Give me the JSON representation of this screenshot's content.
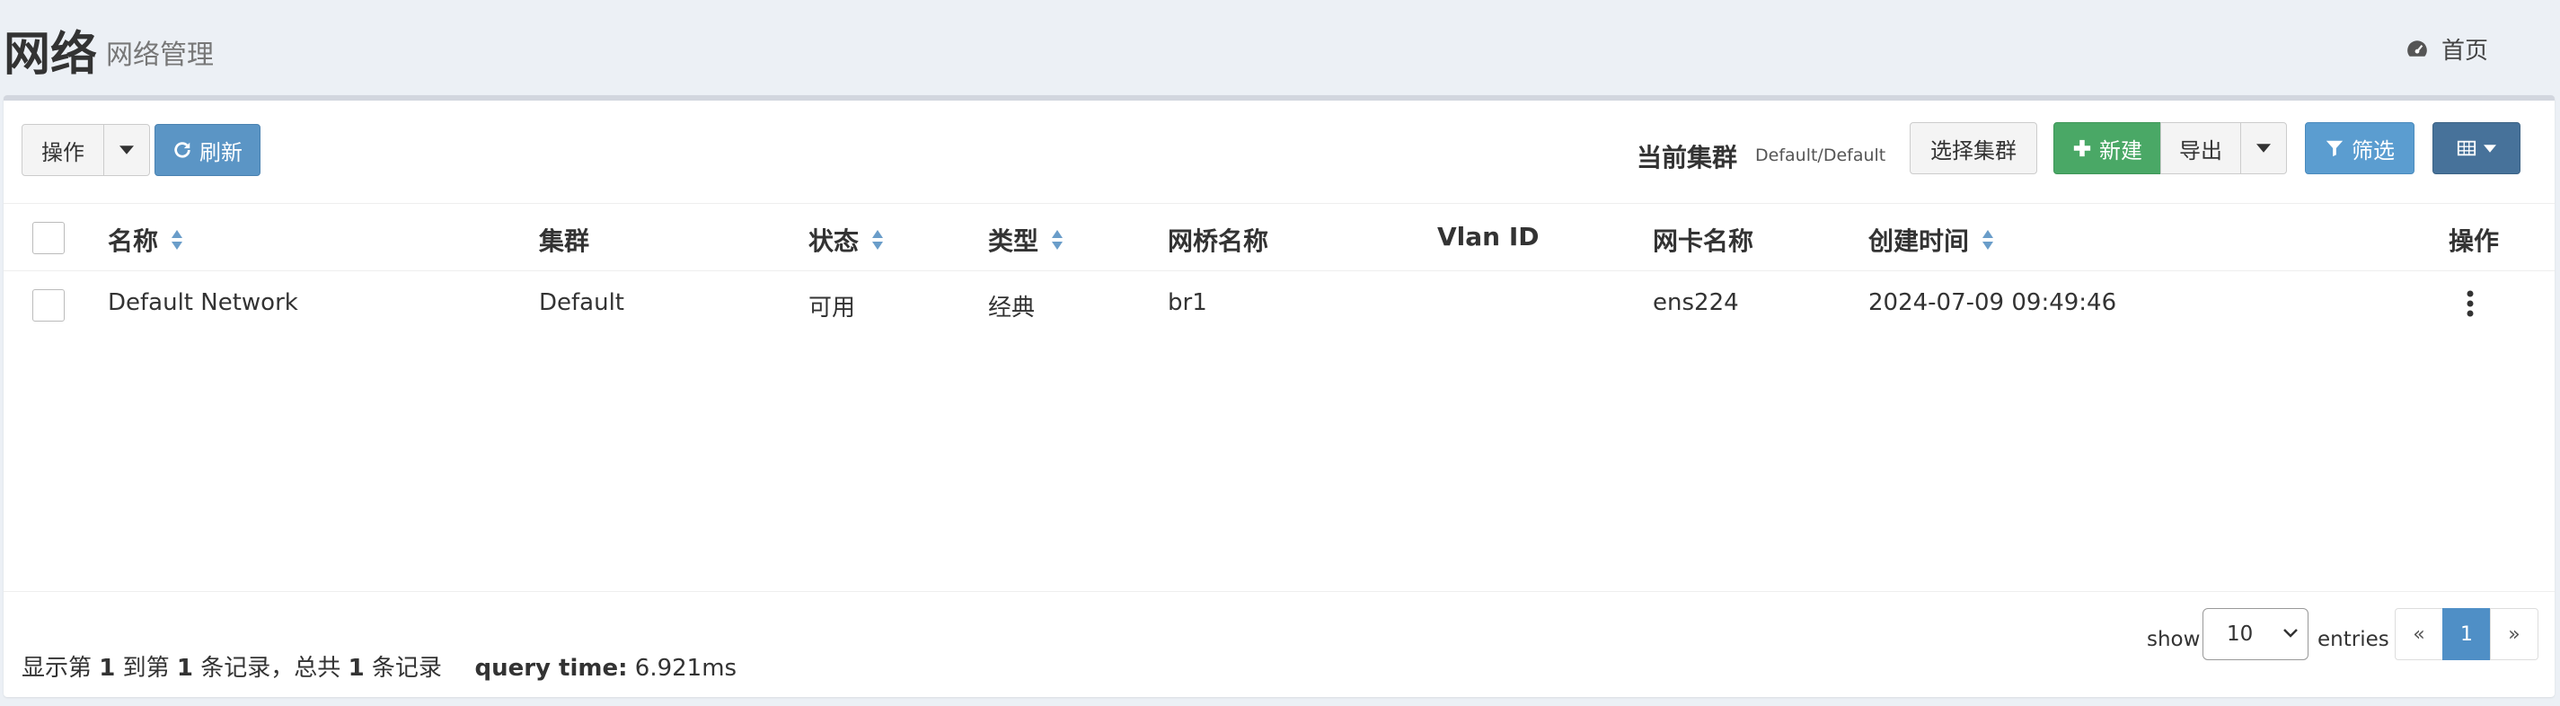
{
  "header": {
    "title": "网络",
    "subtitle": "网络管理",
    "home_label": "首页"
  },
  "toolbar": {
    "actions_label": "操作",
    "refresh_label": "刷新",
    "current_cluster_label": "当前集群",
    "current_cluster_value": "Default/Default",
    "select_cluster_label": "选择集群",
    "new_label": "新建",
    "export_label": "导出",
    "filter_label": "筛选"
  },
  "table": {
    "columns": [
      "名称",
      "集群",
      "状态",
      "类型",
      "网桥名称",
      "Vlan ID",
      "网卡名称",
      "创建时间",
      "操作"
    ],
    "rows": [
      {
        "name": "Default Network",
        "cluster": "Default",
        "status": "可用",
        "type": "经典",
        "bridge": "br1",
        "vlan": "",
        "nic": "ens224",
        "created": "2024-07-09 09:49:46"
      }
    ]
  },
  "footer": {
    "summary_prefix": "显示第",
    "from": "1",
    "summary_mid1": "到第",
    "to": "1",
    "summary_mid2": "条记录，总共",
    "total": "1",
    "summary_suffix": "条记录",
    "query_time_label": "query time:",
    "query_time_value": "6.921ms",
    "show_label": "show",
    "page_size": "10",
    "entries_label": "entries",
    "prev": "«",
    "current_page": "1",
    "next": "»"
  },
  "colors": {
    "primary": "#5b95c5",
    "success": "#4aa866",
    "info": "#5b9dd0",
    "dark": "#47729a",
    "background": "#ecf0f5"
  }
}
